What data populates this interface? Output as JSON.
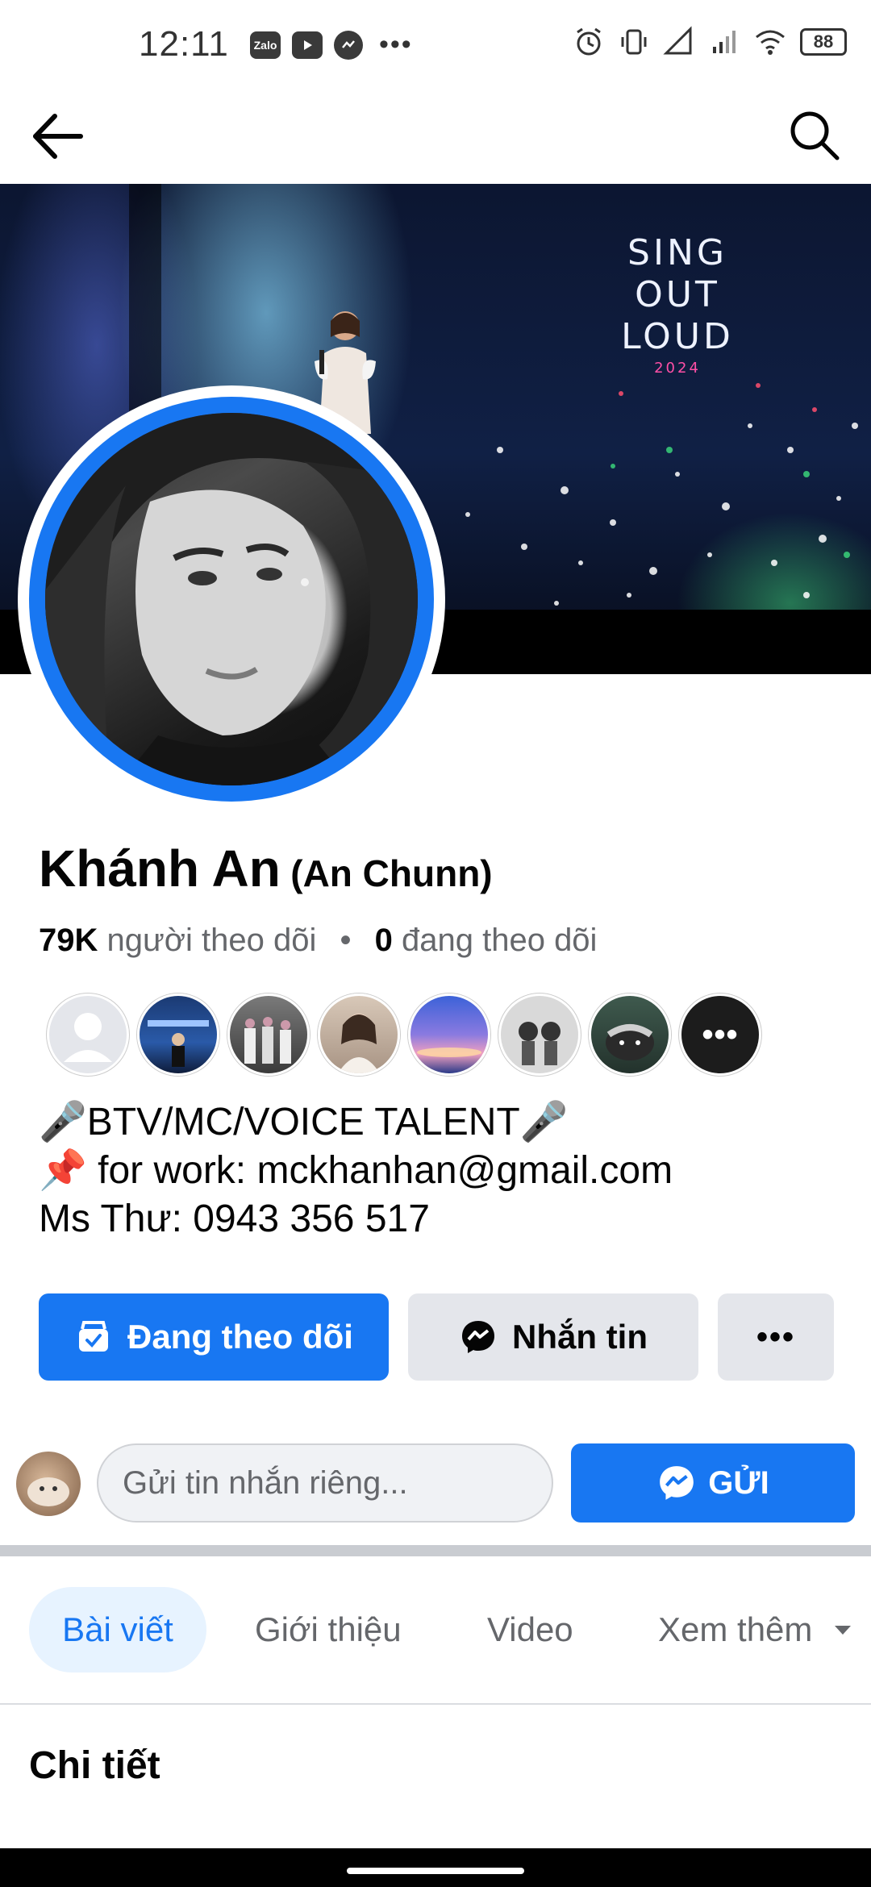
{
  "status_bar": {
    "time": "12:11",
    "notifications": [
      "Zalo",
      "youtube-icon",
      "messenger-icon"
    ],
    "battery": "88",
    "icons": [
      "alarm-icon",
      "vibrate-icon",
      "signal-icon",
      "wifi-icon",
      "battery-icon"
    ]
  },
  "profile": {
    "name": "Khánh An",
    "alt_name": "(An Chunn)",
    "followers_count": "79K",
    "followers_label": "người theo dõi",
    "following_count": "0",
    "following_label": "đang theo dõi",
    "separator": "•"
  },
  "cover": {
    "line1": "SING",
    "line2": "OUT",
    "line3": "LOUD",
    "year": "2024"
  },
  "friends_more": "•••",
  "bio": {
    "line1": "🎤BTV/MC/VOICE TALENT🎤",
    "line2": "📌 for work: mckhanhan@gmail.com",
    "line3": "Ms Thư: 0943 356 517"
  },
  "actions": {
    "follow": "Đang theo dõi",
    "message": "Nhắn tin",
    "more": "•••"
  },
  "message_row": {
    "placeholder": "Gửi tin nhắn riêng...",
    "send": "GỬI"
  },
  "tabs": [
    {
      "label": "Bài viết"
    },
    {
      "label": "Giới thiệu"
    },
    {
      "label": "Video"
    },
    {
      "label": "Xem thêm"
    }
  ],
  "section": {
    "title": "Chi tiết"
  },
  "colors": {
    "accent": "#1877f2",
    "button_gray": "#e4e6eb",
    "tab_active_bg": "#e7f3ff"
  }
}
